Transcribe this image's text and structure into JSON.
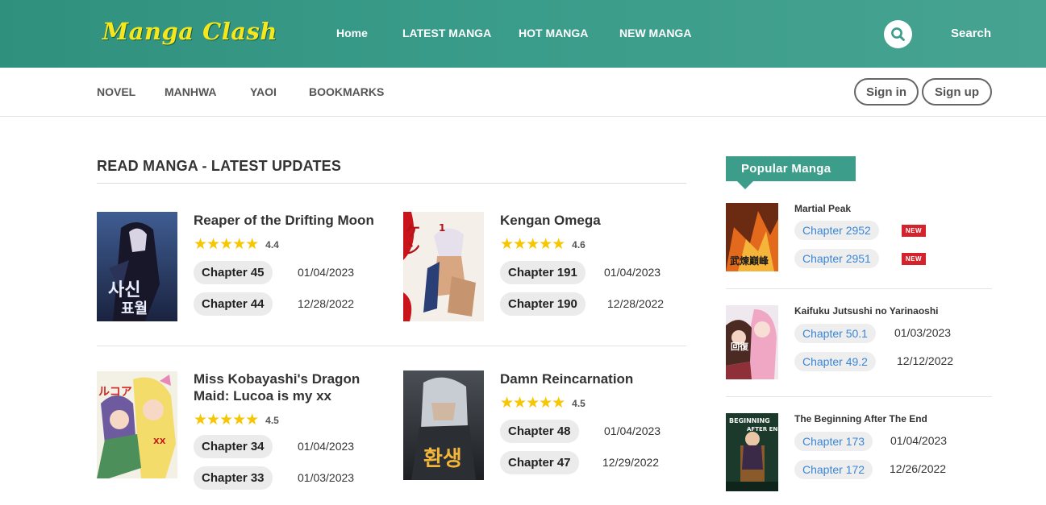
{
  "brand": {
    "logo": "Manga Clash",
    "logo_color": "#f6e71d",
    "header_color": "#3a9c8a"
  },
  "main_nav": [
    "Home",
    "LATEST MANGA",
    "HOT MANGA",
    "NEW MANGA"
  ],
  "search": {
    "label": "Search",
    "icon": "search-icon"
  },
  "sub_nav": [
    "NOVEL",
    "MANHWA",
    "YAOI",
    "BOOKMARKS"
  ],
  "auth": {
    "sign_in": "Sign in",
    "sign_up": "Sign up"
  },
  "latest": {
    "heading": "READ MANGA - LATEST UPDATES",
    "items": [
      {
        "title": "Reaper of the Drifting Moon",
        "stars": "★★★★★",
        "rating": "4.4",
        "chapters": [
          {
            "label": "Chapter 45",
            "date": "01/04/2023"
          },
          {
            "label": "Chapter 44",
            "date": "12/28/2022"
          }
        ]
      },
      {
        "title": "Kengan Omega",
        "stars": "★★★★★",
        "rating": "4.6",
        "chapters": [
          {
            "label": "Chapter 191",
            "date": "01/04/2023"
          },
          {
            "label": "Chapter 190",
            "date": "12/28/2022"
          }
        ]
      },
      {
        "title": "Miss Kobayashi's Dragon Maid: Lucoa is my xx",
        "stars": "★★★★★",
        "rating": "4.5",
        "chapters": [
          {
            "label": "Chapter 34",
            "date": "01/04/2023"
          },
          {
            "label": "Chapter 33",
            "date": "01/03/2023"
          }
        ]
      },
      {
        "title": "Damn Reincarnation",
        "stars": "★★★★★",
        "rating": "4.5",
        "chapters": [
          {
            "label": "Chapter 48",
            "date": "01/04/2023"
          },
          {
            "label": "Chapter 47",
            "date": "12/29/2022"
          }
        ]
      }
    ]
  },
  "popular": {
    "heading": "Popular Manga",
    "items": [
      {
        "title": "Martial Peak",
        "chapters": [
          {
            "label": "Chapter 2952",
            "badge": "NEW"
          },
          {
            "label": "Chapter 2951",
            "badge": "NEW"
          }
        ]
      },
      {
        "title": "Kaifuku Jutsushi no Yarinaoshi",
        "chapters": [
          {
            "label": "Chapter 50.1",
            "date": "01/03/2023"
          },
          {
            "label": "Chapter 49.2",
            "date": "12/12/2022"
          }
        ]
      },
      {
        "title": "The Beginning After The End",
        "chapters": [
          {
            "label": "Chapter 173",
            "date": "01/04/2023"
          },
          {
            "label": "Chapter 172",
            "date": "12/26/2022"
          }
        ]
      }
    ]
  }
}
